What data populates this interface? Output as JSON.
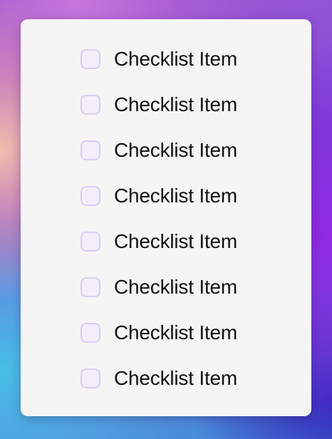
{
  "checklist": {
    "items": [
      {
        "label": "Checklist Item",
        "checked": false
      },
      {
        "label": "Checklist Item",
        "checked": false
      },
      {
        "label": "Checklist Item",
        "checked": false
      },
      {
        "label": "Checklist Item",
        "checked": false
      },
      {
        "label": "Checklist Item",
        "checked": false
      },
      {
        "label": "Checklist Item",
        "checked": false
      },
      {
        "label": "Checklist Item",
        "checked": false
      },
      {
        "label": "Checklist Item",
        "checked": false
      }
    ]
  },
  "colors": {
    "card_background": "#f6f5f6",
    "checkbox_border": "#d9cdf3",
    "checkbox_fill": "#f3eefc",
    "text": "#111111"
  }
}
